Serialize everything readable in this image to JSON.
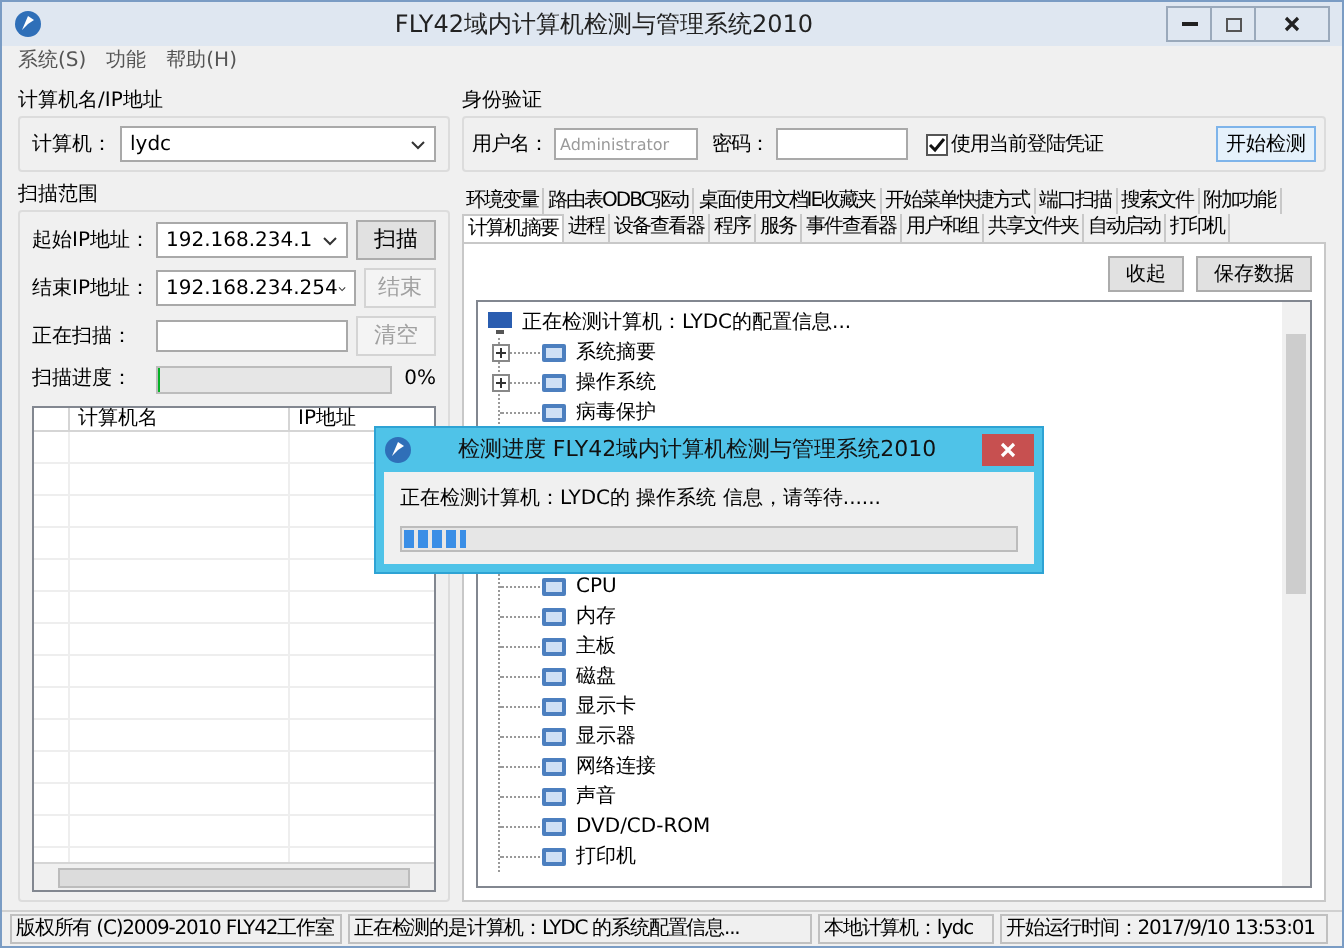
{
  "window": {
    "title": "FLY42域内计算机检测与管理系统2010"
  },
  "menu": [
    {
      "label": "系统(S)"
    },
    {
      "label": "功能"
    },
    {
      "label": "帮助(H)"
    }
  ],
  "computer_group": {
    "title": "计算机名/IP地址",
    "label": "计算机：",
    "value": "lydc"
  },
  "scan_group": {
    "title": "扫描范围",
    "start_label": "起始IP地址：",
    "start_value": "192.168.234.1",
    "end_label": "结束IP地址：",
    "end_value": "192.168.234.254",
    "scanning_label": "正在扫描：",
    "progress_label": "扫描进度：",
    "progress": {
      "level": 0,
      "reading": "0%"
    },
    "buttons": [
      {
        "label": "扫描",
        "disabled": false
      },
      {
        "label": "结束",
        "disabled": true
      },
      {
        "label": "清空",
        "disabled": true
      }
    ],
    "table": {
      "columns": [
        "计算机名",
        "IP地址"
      ]
    }
  },
  "auth_group": {
    "title": "身份验证",
    "username_label": "用户名：",
    "username_placeholder": "Administrator",
    "password_label": "密码：",
    "use_current": {
      "label": "使用当前登陆凭证",
      "checked": true
    },
    "start_button": "开始检测"
  },
  "tabs": [
    [
      {
        "label": "环境变量",
        "selected": false
      },
      {
        "label": "路由表ODBC驱动",
        "selected": false
      },
      {
        "label": "桌面使用文档IE收藏夹",
        "selected": false
      },
      {
        "label": "开始菜单快捷方式",
        "selected": false
      },
      {
        "label": "端口扫描",
        "selected": false
      },
      {
        "label": "搜索文件",
        "selected": false
      },
      {
        "label": "附加功能",
        "selected": false
      }
    ],
    [
      {
        "label": "计算机摘要",
        "selected": true
      },
      {
        "label": "进程",
        "selected": false
      },
      {
        "label": "设备查看器",
        "selected": false
      },
      {
        "label": "程序",
        "selected": false
      },
      {
        "label": "服务",
        "selected": false
      },
      {
        "label": "事件查看器",
        "selected": false
      },
      {
        "label": "用户和组",
        "selected": false
      },
      {
        "label": "共享文件夹",
        "selected": false
      },
      {
        "label": "自动启动",
        "selected": false
      },
      {
        "label": "打印机",
        "selected": false
      }
    ]
  ],
  "panel": {
    "buttons": [
      "收起",
      "保存数据"
    ],
    "tree": {
      "label": "正在检测计算机：LYDC的配置信息...",
      "children": [
        {
          "label": "系统摘要",
          "kind": "group"
        },
        {
          "label": "操作系统",
          "kind": "group"
        },
        {
          "label": "病毒保护",
          "kind": "leaf"
        },
        {
          "label": "CPU",
          "kind": "leaf"
        },
        {
          "label": "内存",
          "kind": "leaf"
        },
        {
          "label": "主板",
          "kind": "leaf"
        },
        {
          "label": "磁盘",
          "kind": "leaf"
        },
        {
          "label": "显示卡",
          "kind": "leaf"
        },
        {
          "label": "显示器",
          "kind": "leaf"
        },
        {
          "label": "网络连接",
          "kind": "leaf"
        },
        {
          "label": "声音",
          "kind": "leaf"
        },
        {
          "label": "DVD/CD-ROM",
          "kind": "leaf"
        },
        {
          "label": "打印机",
          "kind": "leaf"
        }
      ]
    }
  },
  "dialog": {
    "title": "检测进度 FLY42域内计算机检测与管理系统2010",
    "message": "正在检测计算机：LYDC的 操作系统 信息，请等待......",
    "progress": {
      "level": 0.1
    }
  },
  "status_bar": [
    "版权所有 (C)2009-2010 FLY42工作室",
    "正在检测的是计算机：LYDC 的系统配置信息...",
    "本地计算机：lydc",
    "开始运行时间：2017/9/10 13:53:01"
  ]
}
